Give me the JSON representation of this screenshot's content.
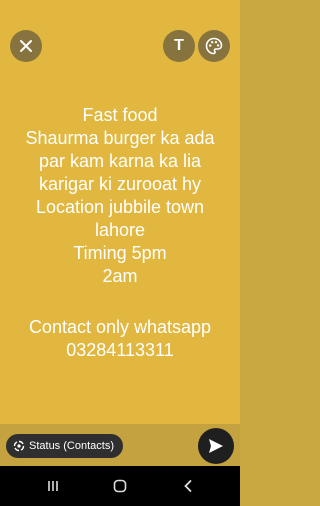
{
  "toolbar": {
    "close_icon": "close-icon",
    "text_tool_label": "T",
    "palette_icon": "palette-icon"
  },
  "message": {
    "lines_top": [
      "Fast food",
      "Shaurma burger  ka ada",
      "par kam karna ka lia",
      "karigar ki zurooat hy",
      "Location jubbile town",
      "lahore",
      "Timing 5pm",
      "2am"
    ],
    "lines_bottom": [
      "Contact only whatsapp",
      "03284113311"
    ]
  },
  "bottom_bar": {
    "audience_label": "Status (Contacts)",
    "send_icon": "send-icon"
  },
  "colors": {
    "background": "#e1b740",
    "text": "#ffffff",
    "chip": "#2f2f2f"
  }
}
